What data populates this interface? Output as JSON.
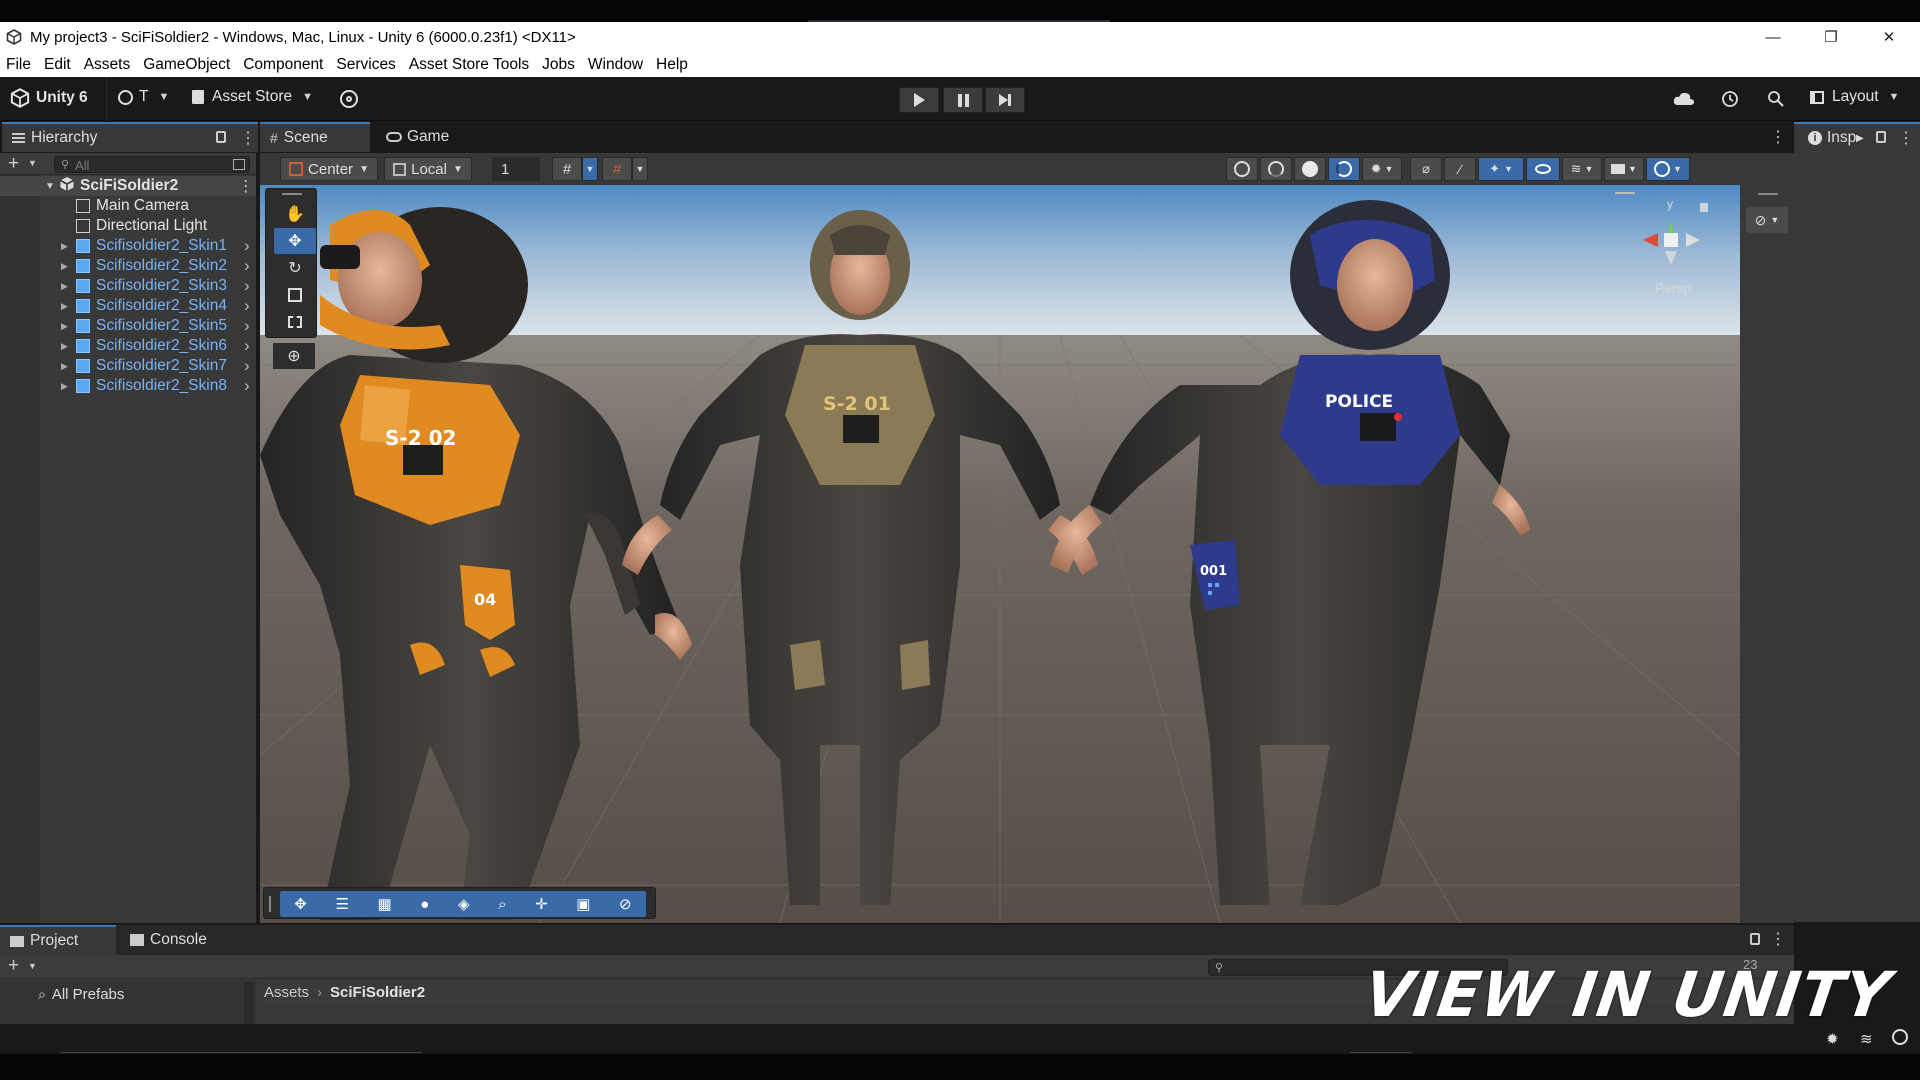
{
  "window": {
    "title": "My project3 - SciFiSoldier2 - Windows, Mac, Linux - Unity 6 (6000.0.23f1) <DX11>",
    "controls": [
      "—",
      "❐",
      "✕"
    ]
  },
  "menu": [
    "File",
    "Edit",
    "Assets",
    "GameObject",
    "Component",
    "Services",
    "Asset Store Tools",
    "Jobs",
    "Window",
    "Help"
  ],
  "toolbar": {
    "unity_label": "Unity 6",
    "account_label": "T",
    "asset_store_label": "Asset Store",
    "layout_label": "Layout"
  },
  "hierarchy": {
    "tab_label": "Hierarchy",
    "search_placeholder": "All",
    "scene_name": "SciFiSoldier2",
    "items": [
      {
        "label": "Main Camera",
        "type": "gameobject"
      },
      {
        "label": "Directional Light",
        "type": "gameobject"
      },
      {
        "label": "Scifisoldier2_Skin1",
        "type": "prefab"
      },
      {
        "label": "Scifisoldier2_Skin2",
        "type": "prefab"
      },
      {
        "label": "Scifisoldier2_Skin3",
        "type": "prefab"
      },
      {
        "label": "Scifisoldier2_Skin4",
        "type": "prefab"
      },
      {
        "label": "Scifisoldier2_Skin5",
        "type": "prefab"
      },
      {
        "label": "Scifisoldier2_Skin6",
        "type": "prefab"
      },
      {
        "label": "Scifisoldier2_Skin7",
        "type": "prefab"
      },
      {
        "label": "Scifisoldier2_Skin8",
        "type": "prefab"
      }
    ]
  },
  "scene": {
    "tab_scene": "Scene",
    "tab_game": "Game",
    "pivot_label": "Center",
    "space_label": "Local",
    "grid_value": "1",
    "persp_label": "Persp",
    "gizmo_y": "y",
    "soldier_labels": {
      "left_chest": "S-2  02",
      "left_thigh": "04",
      "center_chest": "S-2  01",
      "right_chest": "POLICE",
      "right_thigh": "001"
    }
  },
  "inspector": {
    "tab_label": "Insp"
  },
  "project": {
    "tab_project": "Project",
    "tab_console": "Console",
    "all_prefabs": "All Prefabs",
    "breadcrumb": [
      "Assets",
      "SciFiSoldier2"
    ],
    "count_badge": "23"
  },
  "watermark": "VIEW IN UNITY",
  "colors": {
    "accent_blue": "#3a79bb",
    "prefab_blue": "#7ab3f4",
    "panel": "#383838",
    "toolbar": "#191919",
    "orange_armor": "#e08a22",
    "tan_armor": "#8a7a55",
    "blue_armor": "#2e3a8c"
  }
}
